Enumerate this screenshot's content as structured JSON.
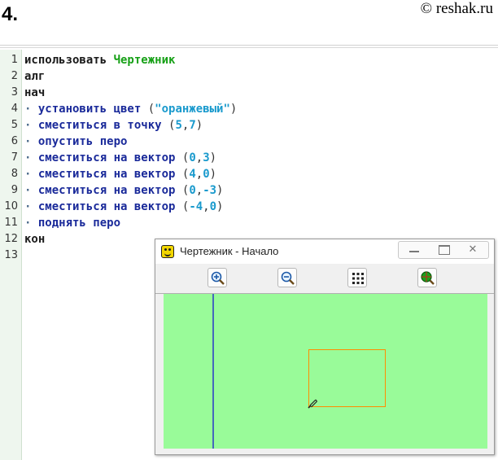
{
  "header": {
    "task_number": "4.",
    "copyright": "© reshak.ru"
  },
  "colors": {
    "canvas": "#99fb99",
    "axis": "#1a1ad0",
    "rectangle": "#ff8c00"
  },
  "code_lines": [
    {
      "n": "1",
      "tokens": [
        {
          "t": "использовать ",
          "c": "kw"
        },
        {
          "t": "Чертежник",
          "c": "ident"
        }
      ]
    },
    {
      "n": "2",
      "tokens": [
        {
          "t": "алг",
          "c": "kw"
        }
      ]
    },
    {
      "n": "3",
      "tokens": [
        {
          "t": "нач",
          "c": "kw"
        }
      ]
    },
    {
      "n": "4",
      "tokens": [
        {
          "t": "· ",
          "c": "dot"
        },
        {
          "t": "установить цвет ",
          "c": "cmd"
        },
        {
          "t": "(",
          "c": "punc"
        },
        {
          "t": "\"оранжевый\"",
          "c": "str"
        },
        {
          "t": ")",
          "c": "punc"
        }
      ]
    },
    {
      "n": "5",
      "tokens": [
        {
          "t": "· ",
          "c": "dot"
        },
        {
          "t": "сместиться в точку ",
          "c": "cmd"
        },
        {
          "t": "(",
          "c": "punc"
        },
        {
          "t": "5",
          "c": "num"
        },
        {
          "t": ",",
          "c": "punc"
        },
        {
          "t": "7",
          "c": "num"
        },
        {
          "t": ")",
          "c": "punc"
        }
      ]
    },
    {
      "n": "6",
      "tokens": [
        {
          "t": "· ",
          "c": "dot"
        },
        {
          "t": "опустить перо",
          "c": "cmd"
        }
      ]
    },
    {
      "n": "7",
      "tokens": [
        {
          "t": "· ",
          "c": "dot"
        },
        {
          "t": "сместиться на вектор ",
          "c": "cmd"
        },
        {
          "t": "(",
          "c": "punc"
        },
        {
          "t": "0",
          "c": "num"
        },
        {
          "t": ",",
          "c": "punc"
        },
        {
          "t": "3",
          "c": "num"
        },
        {
          "t": ")",
          "c": "punc"
        }
      ]
    },
    {
      "n": "8",
      "tokens": [
        {
          "t": "· ",
          "c": "dot"
        },
        {
          "t": "сместиться на вектор ",
          "c": "cmd"
        },
        {
          "t": "(",
          "c": "punc"
        },
        {
          "t": "4",
          "c": "num"
        },
        {
          "t": ",",
          "c": "punc"
        },
        {
          "t": "0",
          "c": "num"
        },
        {
          "t": ")",
          "c": "punc"
        }
      ]
    },
    {
      "n": "9",
      "tokens": [
        {
          "t": "· ",
          "c": "dot"
        },
        {
          "t": "сместиться на вектор ",
          "c": "cmd"
        },
        {
          "t": "(",
          "c": "punc"
        },
        {
          "t": "0",
          "c": "num"
        },
        {
          "t": ",",
          "c": "punc"
        },
        {
          "t": "-3",
          "c": "num"
        },
        {
          "t": ")",
          "c": "punc"
        }
      ]
    },
    {
      "n": "10",
      "tokens": [
        {
          "t": "· ",
          "c": "dot"
        },
        {
          "t": "сместиться на вектор ",
          "c": "cmd"
        },
        {
          "t": "(",
          "c": "punc"
        },
        {
          "t": "-4",
          "c": "num"
        },
        {
          "t": ",",
          "c": "punc"
        },
        {
          "t": "0",
          "c": "num"
        },
        {
          "t": ")",
          "c": "punc"
        }
      ]
    },
    {
      "n": "11",
      "tokens": [
        {
          "t": "· ",
          "c": "dot"
        },
        {
          "t": "поднять перо",
          "c": "cmd"
        }
      ]
    },
    {
      "n": "12",
      "tokens": [
        {
          "t": "кон",
          "c": "kw"
        }
      ]
    },
    {
      "n": "13",
      "tokens": []
    }
  ],
  "drawer_window": {
    "title": "Чертежник - Начало",
    "controls": {
      "close_glyph": "✕"
    },
    "toolbar": [
      {
        "name": "zoom-in-icon"
      },
      {
        "name": "zoom-out-icon"
      },
      {
        "name": "grid-icon"
      },
      {
        "name": "fit-view-icon"
      }
    ]
  }
}
